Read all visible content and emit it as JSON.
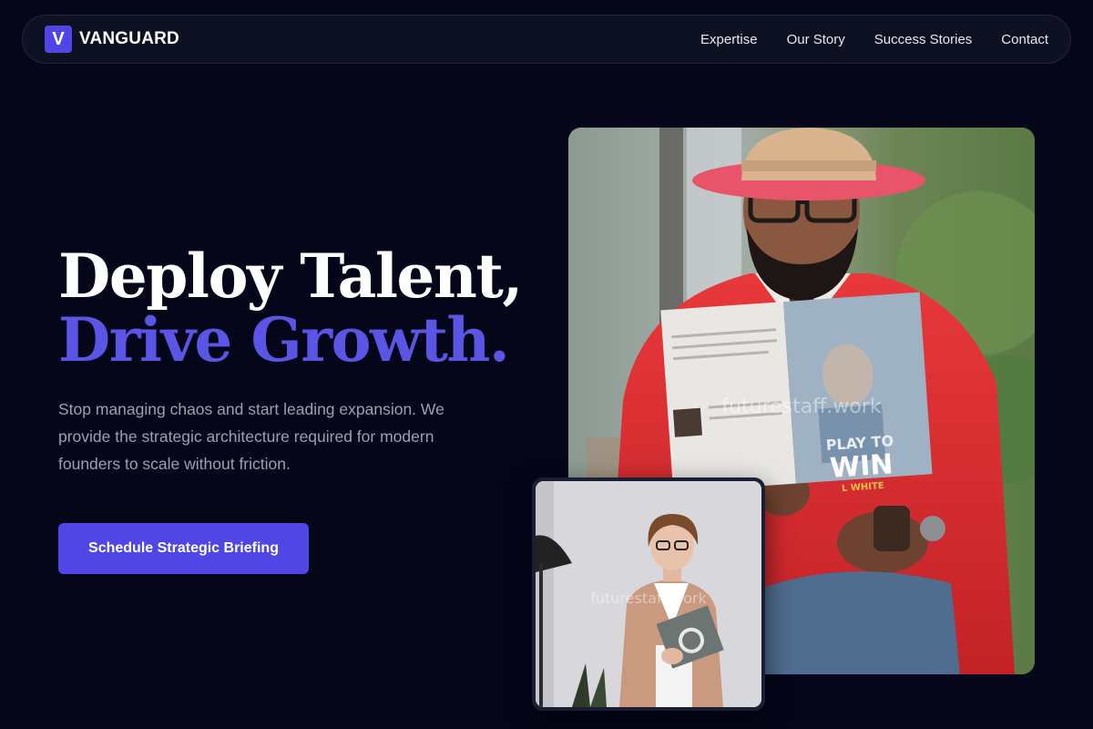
{
  "brand": {
    "logo_letter": "V",
    "name": "VANGUARD",
    "accent_color": "#5046e5"
  },
  "nav": {
    "links": [
      "Expertise",
      "Our Story",
      "Success Stories",
      "Contact"
    ]
  },
  "hero": {
    "headline_line1": "Deploy Talent,",
    "headline_line2": "Drive Growth.",
    "subtext": "Stop managing chaos and start leading expansion. We provide the strategic architecture required for modern founders to scale without friction.",
    "cta_label": "Schedule Strategic Briefing"
  },
  "images": {
    "main": {
      "watermark": "futurestaff.work",
      "book_title_line1": "PLAY TO",
      "book_title_line2": "WIN",
      "book_author": "L WHITE"
    },
    "inset": {
      "watermark": "futurestaff.work"
    }
  }
}
